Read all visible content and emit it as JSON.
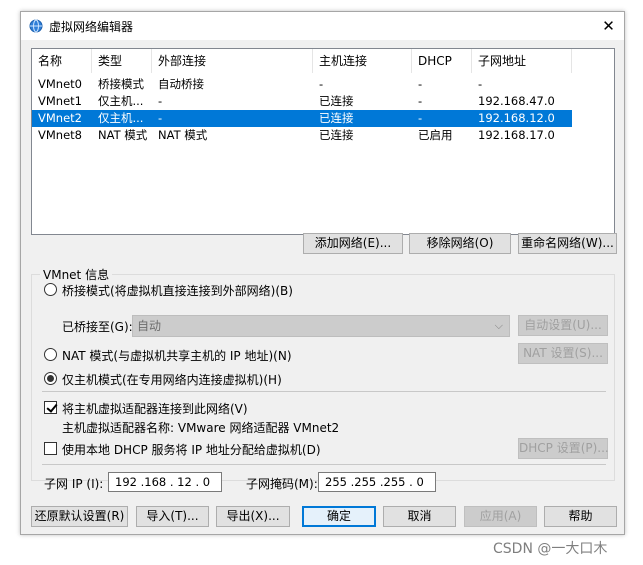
{
  "window": {
    "title": "虚拟网络编辑器",
    "close_glyph": "✕"
  },
  "network_table": {
    "columns": [
      "名称",
      "类型",
      "外部连接",
      "主机连接",
      "DHCP",
      "子网地址"
    ],
    "rows": [
      [
        "VMnet0",
        "桥接模式",
        "自动桥接",
        "-",
        "-",
        "-"
      ],
      [
        "VMnet1",
        "仅主机...",
        "-",
        "已连接",
        "-",
        "192.168.47.0"
      ],
      [
        "VMnet2",
        "仅主机...",
        "-",
        "已连接",
        "-",
        "192.168.12.0"
      ],
      [
        "VMnet8",
        "NAT 模式",
        "NAT 模式",
        "已连接",
        "已启用",
        "192.168.17.0"
      ]
    ],
    "selected_index": 2
  },
  "list_buttons": {
    "add": "添加网络(E)...",
    "remove": "移除网络(O)",
    "rename": "重命名网络(W)..."
  },
  "vmnet_info": {
    "group_label": "VMnet 信息",
    "bridged_label": "桥接模式(将虚拟机直接连接到外部网络)(B)",
    "bridged_to_label": "已桥接至(G):",
    "bridged_to_value": "自动",
    "auto_settings": "自动设置(U)...",
    "nat_label": "NAT 模式(与虚拟机共享主机的 IP 地址)(N)",
    "nat_settings": "NAT 设置(S)...",
    "host_only_label": "仅主机模式(在专用网络内连接虚拟机)(H)",
    "connect_adapter_label": "将主机虚拟适配器连接到此网络(V)",
    "adapter_name_label": "主机虚拟适配器名称: VMware 网络适配器 VMnet2",
    "dhcp_label": "使用本地 DHCP 服务将 IP 地址分配给虚拟机(D)",
    "dhcp_settings": "DHCP 设置(P)...",
    "subnet_ip_label": "子网 IP (I):",
    "subnet_ip_value": "192 .168 . 12  .  0",
    "subnet_mask_label": "子网掩码(M):",
    "subnet_mask_value": "255 .255 .255 .  0",
    "mode": "host-only",
    "connect_adapter_checked": true,
    "dhcp_checked": false
  },
  "footer_buttons": {
    "restore": "还原默认设置(R)",
    "import": "导入(T)...",
    "export": "导出(X)...",
    "ok": "确定",
    "cancel": "取消",
    "apply": "应用(A)",
    "help": "帮助"
  },
  "watermark": "CSDN @一大口木",
  "icons": {
    "title": "network-globe-icon",
    "dropdown": "chevron-down-icon"
  },
  "colors": {
    "selection": "#0078d7",
    "window_bg": "#f0f0f0"
  }
}
